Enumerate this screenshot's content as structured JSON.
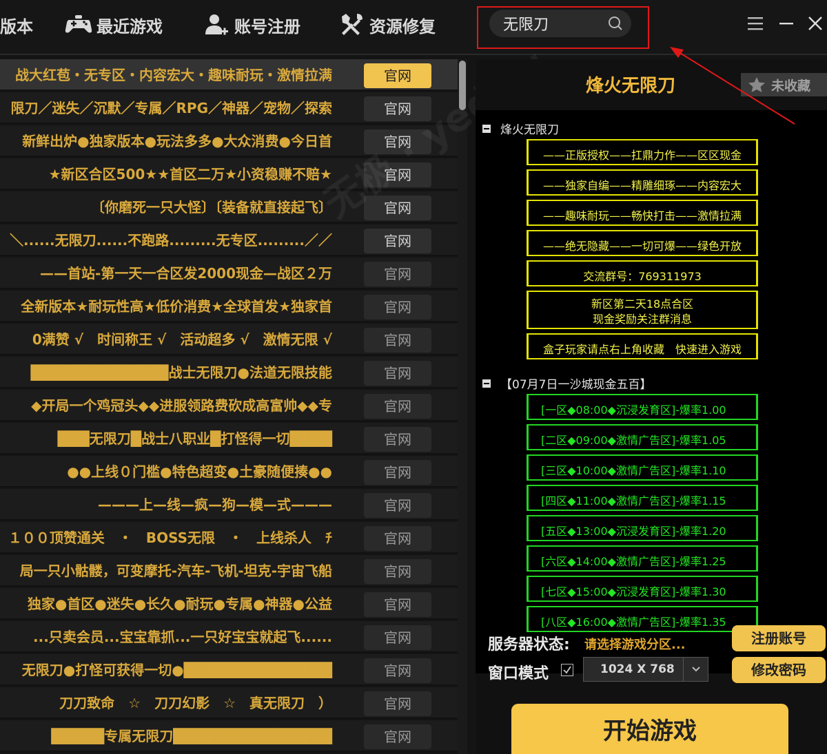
{
  "nav": {
    "items": [
      {
        "label": "版本",
        "icon": "version-icon"
      },
      {
        "label": "最近游戏",
        "icon": "gamepad-icon"
      },
      {
        "label": "账号注册",
        "icon": "user-add-icon"
      },
      {
        "label": "资源修复",
        "icon": "tools-icon"
      }
    ],
    "search": {
      "value": "无限刀"
    }
  },
  "games": [
    {
      "text": "战大红苞・无专区・内容宏大・趣味耐玩・激情拉满",
      "button": "官网"
    },
    {
      "text": "限刀／迷失／沉默／专属／RPG／神器／宠物／探索",
      "button": "官网"
    },
    {
      "text": "新鲜出炉●独家版本●玩法多多●大众消费●今日首",
      "button": "官网"
    },
    {
      "text": "★新区合区500★★首区二万★小资稳赚不赔★",
      "button": "官网"
    },
    {
      "text": "〔你磨死一只大怪〕〔装备就直接起飞〕",
      "button": "官网"
    },
    {
      "text": "＼......无限刀......不跑路.........无专区.........／／",
      "button": "官网"
    },
    {
      "text": "——首站-第一天一合区发2000现金—战区２万",
      "button": "官网"
    },
    {
      "text": "全新版本★耐玩性高★低价消费★全球首发★独家首",
      "button": "官网"
    },
    {
      "text": "0满赞 √　时间称王 √　活动超多 √　激情无限 √",
      "button": "官网"
    },
    {
      "text": "█████████████战士无限刀●法道无限技能",
      "button": "官网"
    },
    {
      "text": "◆开局一个鸡冠头◆◆进服领路费砍成高富帅◆◆专",
      "button": "官网"
    },
    {
      "text": "███无限刀█战士八职业█打怪得一切████",
      "button": "官网"
    },
    {
      "text": "●●上线０门槛●特色超变●土豪随便揍●●",
      "button": "官网"
    },
    {
      "text": "———上—线—疯—狗—模—式———",
      "button": "官网"
    },
    {
      "text": "１００顶赞通关　・　BOSS无限　・　上线杀人　ﾁ",
      "button": "官网"
    },
    {
      "text": "局一只小骷髅，可变摩托-汽车-飞机-坦克-宇宙飞船",
      "button": "官网"
    },
    {
      "text": "独家●首区●迷失●长久●耐玩●专属●神器●公益",
      "button": "官网"
    },
    {
      "text": "...只卖会员...宝宝靠抓...一只好宝宝就起飞......",
      "button": "官网"
    },
    {
      "text": "无限刀●打怪可获得一切●██████████████",
      "button": "官网"
    },
    {
      "text": "刀刀致命　☆　刀刀幻影　☆　真无限刀　）",
      "button": "官网"
    },
    {
      "text": "█████专属无限刀███████████████",
      "button": "官网"
    }
  ],
  "panel": {
    "title": "烽火无限刀",
    "favorite_label": "未收藏",
    "section1_title": "烽火无限刀",
    "section1_lines": [
      "——正版授权——扛鼎力作——区区现金",
      "——独家自编——精雕细琢——内容宏大",
      "——趣味耐玩——畅快打击——激情拉满",
      "——绝无隐藏——一切可爆——绿色开放",
      "交流群号：769311973",
      "新区第二天18点合区",
      "现金奖励关注群消息",
      "盒子玩家请点右上角收藏　快速进入游戏"
    ],
    "section2_title": "【07月7日一沙城现金五百】",
    "servers": [
      "[一区◆08:00◆沉浸发育区]-爆率1.00",
      "[二区◆09:00◆激情广告区]-爆率1.05",
      "[三区◆10:00◆激情广告区]-爆率1.10",
      "[四区◆11:00◆激情广告区]-爆率1.15",
      "[五区◆13:00◆沉浸发育区]-爆率1.20",
      "[六区◆14:00◆激情广告区]-爆率1.25",
      "[七区◆15:00◆沉浸发育区]-爆率1.30",
      "[八区◆16:00◆激情广告区]-爆率1.35"
    ],
    "status_label": "服务器状态:",
    "status_value": "请选择游戏分区...",
    "mode_label": "窗口模式",
    "resolution": "1024 X 768",
    "register_label": "注册账号",
    "change_pwd_label": "修改密码",
    "start_label": "开始游戏"
  },
  "colors": {
    "accent": "#f1c44f",
    "list_text": "#d9a93c",
    "annotation": "#e01818",
    "server_green": "#22e622",
    "notice_yellow": "#f2f24a"
  }
}
